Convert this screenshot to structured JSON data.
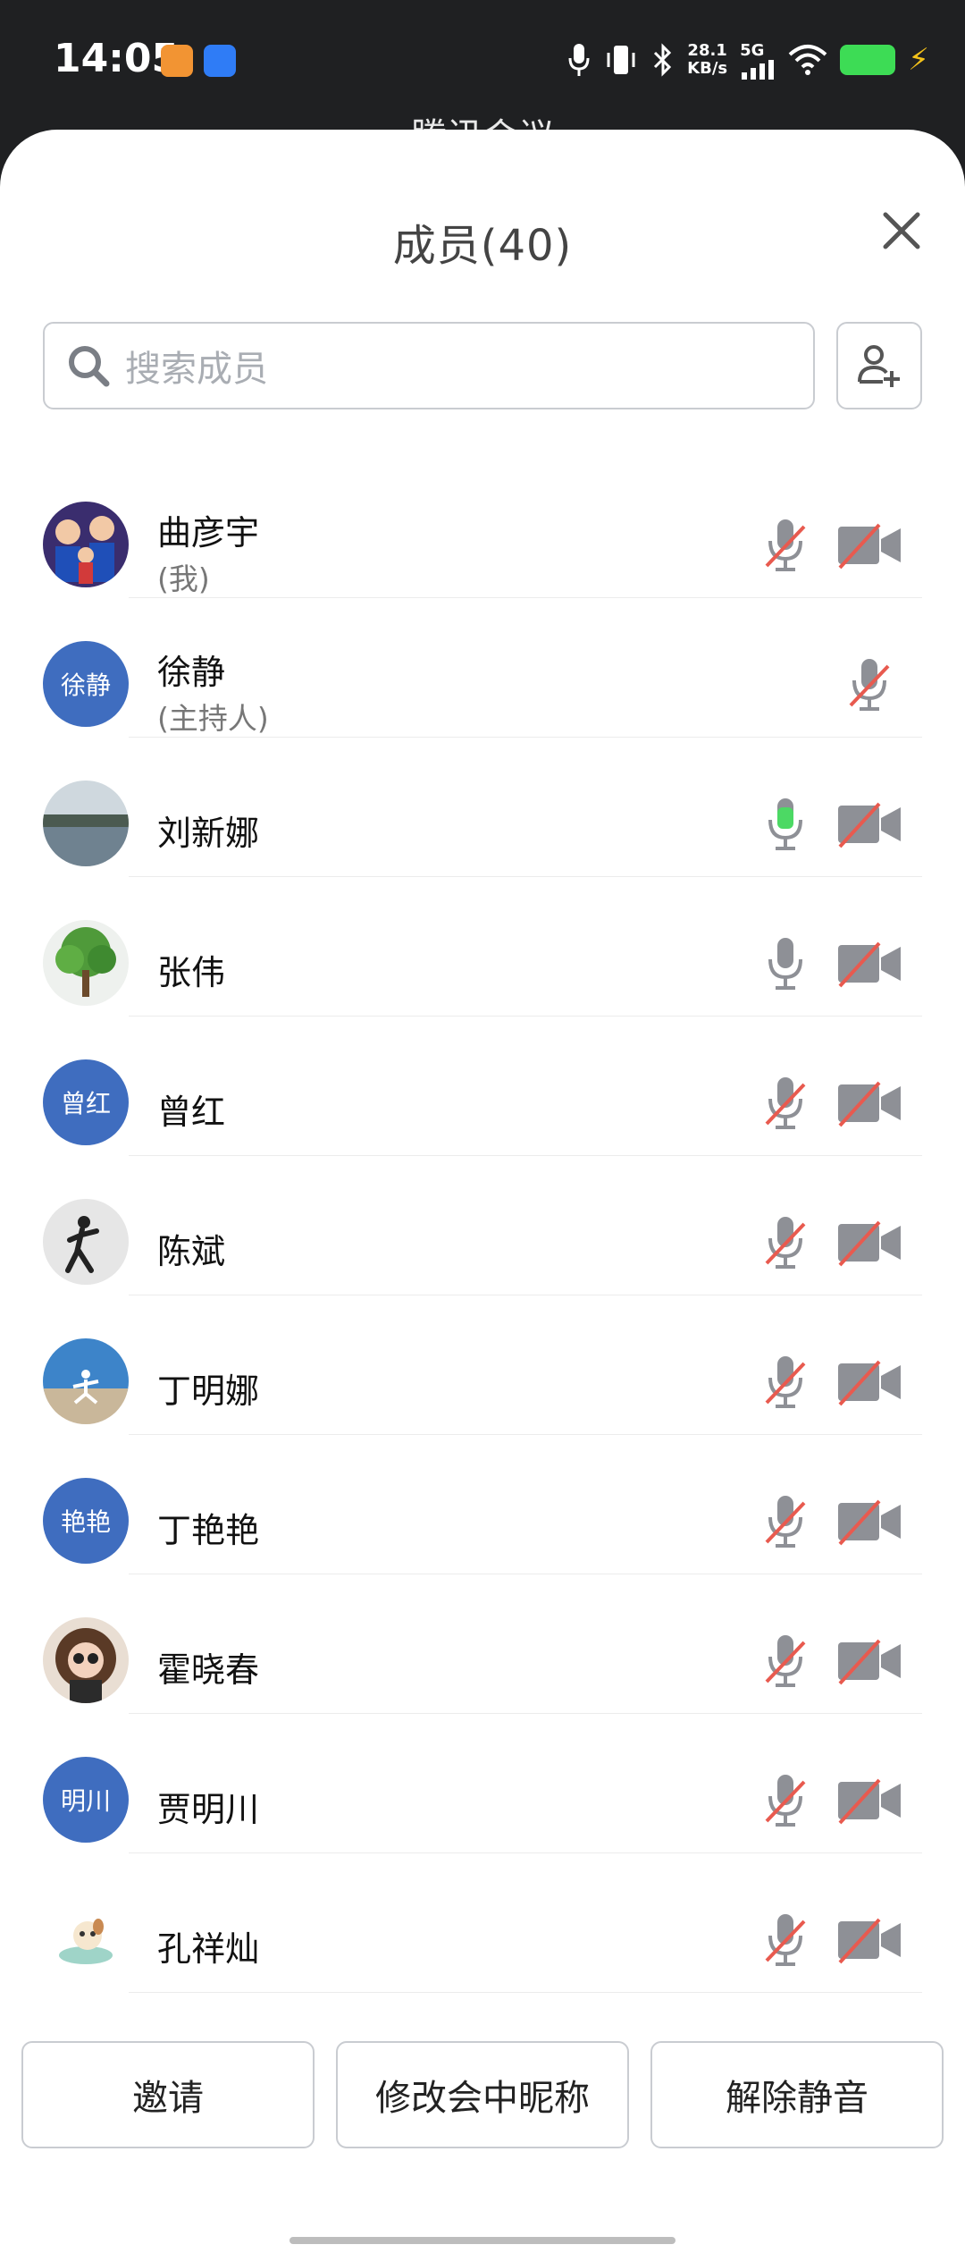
{
  "status_bar": {
    "time": "14:05",
    "speed_top": "28.1",
    "speed_bottom": "KB/s",
    "network": "5G"
  },
  "background_title": "腾讯会议",
  "panel": {
    "title": "成员(40)"
  },
  "search": {
    "placeholder": "搜索成员"
  },
  "members": [
    {
      "name": "曲彦宇",
      "role": "(我)",
      "avatar": "photo-family",
      "mic": "muted",
      "camera": "off"
    },
    {
      "name": "徐静",
      "role": "(主持人)",
      "avatar_text": "徐静",
      "mic": "muted",
      "camera": "none"
    },
    {
      "name": "刘新娜",
      "role": "",
      "avatar": "photo-lake",
      "mic": "speaking",
      "camera": "off"
    },
    {
      "name": "张伟",
      "role": "",
      "avatar": "photo-tree",
      "mic": "on",
      "camera": "off"
    },
    {
      "name": "曾红",
      "role": "",
      "avatar_text": "曾红",
      "mic": "muted",
      "camera": "off"
    },
    {
      "name": "陈斌",
      "role": "",
      "avatar": "photo-dancer",
      "mic": "muted",
      "camera": "off"
    },
    {
      "name": "丁明娜",
      "role": "",
      "avatar": "photo-beach",
      "mic": "muted",
      "camera": "off"
    },
    {
      "name": "丁艳艳",
      "role": "",
      "avatar_text": "艳艳",
      "mic": "muted",
      "camera": "off"
    },
    {
      "name": "霍晓春",
      "role": "",
      "avatar": "photo-girl",
      "mic": "muted",
      "camera": "off"
    },
    {
      "name": "贾明川",
      "role": "",
      "avatar_text": "明川",
      "mic": "muted",
      "camera": "off"
    },
    {
      "name": "孔祥灿",
      "role": "",
      "avatar": "photo-cartoon-dog",
      "mic": "muted",
      "camera": "off"
    }
  ],
  "actions": {
    "invite": "邀请",
    "rename": "修改会中昵称",
    "unmute": "解除静音"
  },
  "colors": {
    "avatar_blue": "#3f6dbf",
    "speaking_green": "#4cd964",
    "mute_red": "#e85a4f",
    "icon_gray": "#8e9096"
  }
}
